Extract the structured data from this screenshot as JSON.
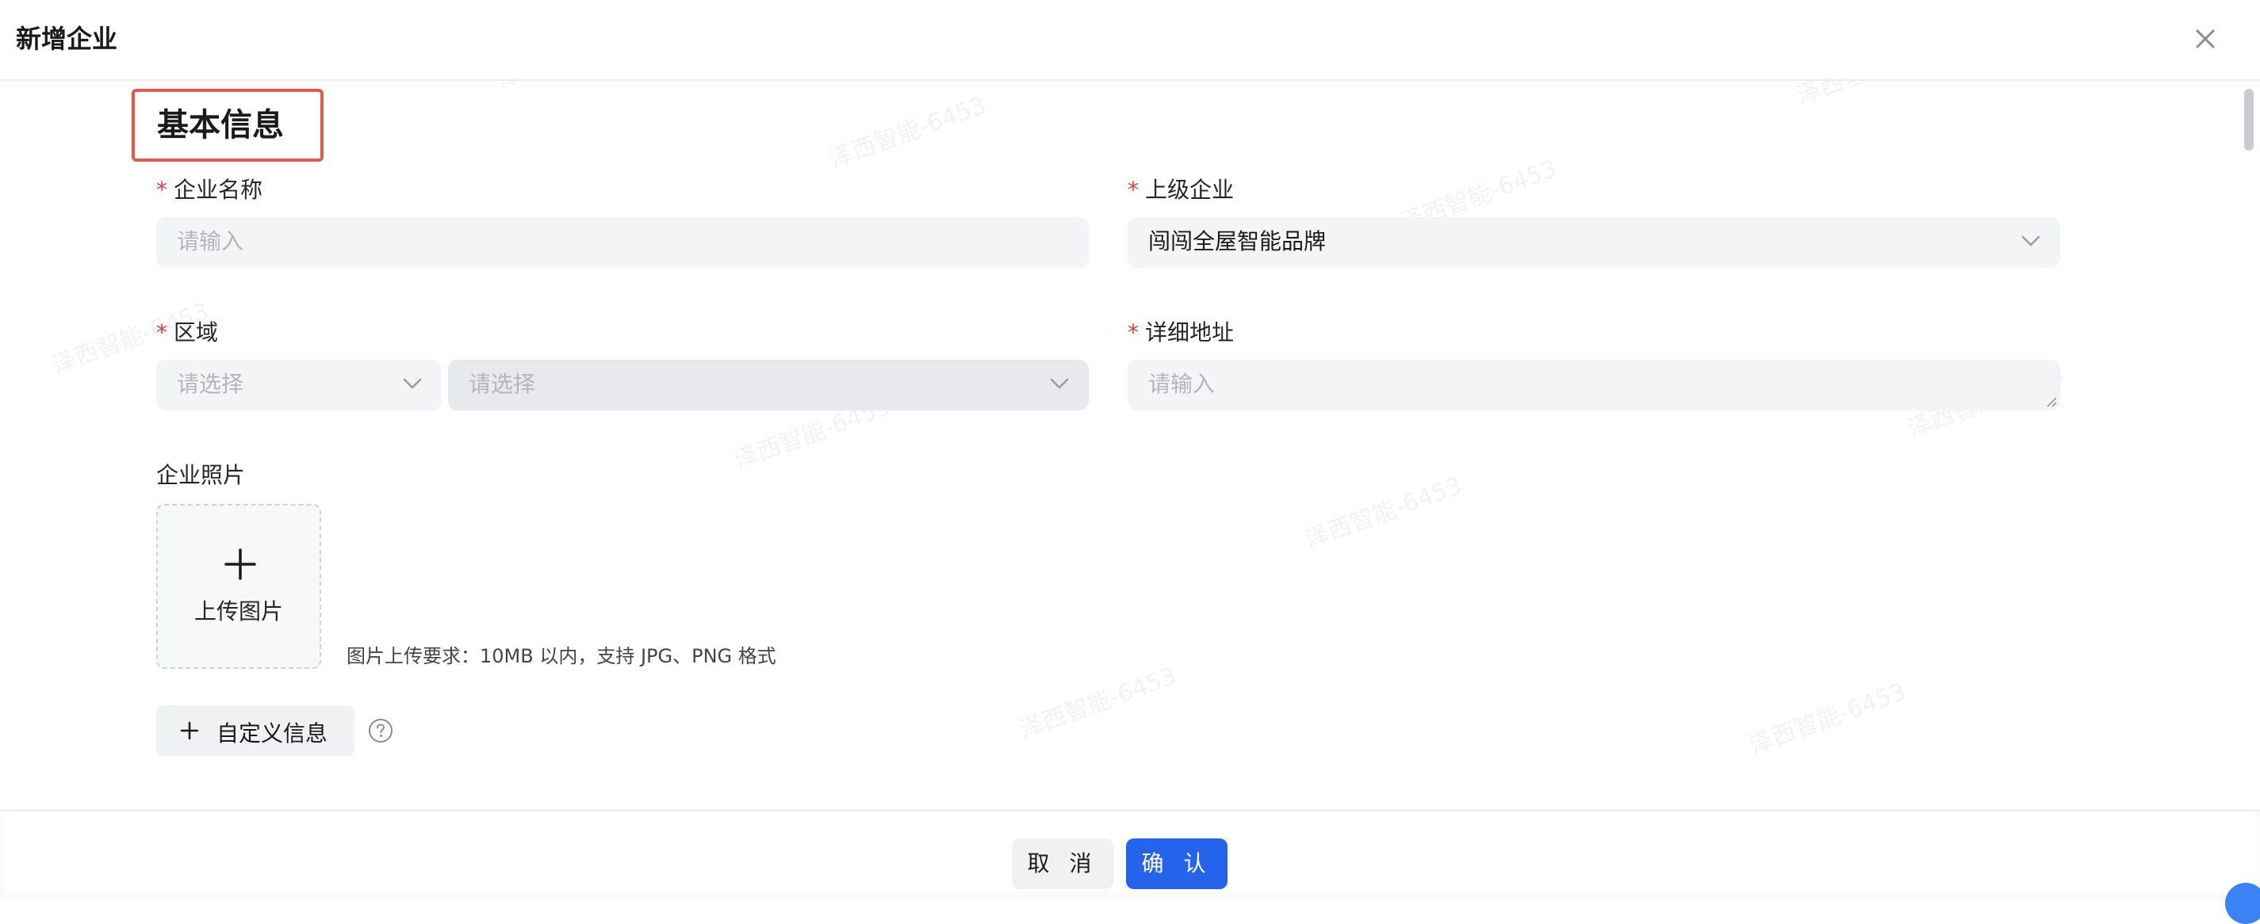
{
  "dialog": {
    "title": "新增企业"
  },
  "section": {
    "title": "基本信息"
  },
  "fields": {
    "company_name": {
      "label": "企业名称",
      "placeholder": "请输入"
    },
    "parent_company": {
      "label": "上级企业",
      "value": "闯闯全屋智能品牌"
    },
    "region": {
      "label": "区域",
      "province_placeholder": "请选择",
      "city_placeholder": "请选择"
    },
    "address": {
      "label": "详细地址",
      "placeholder": "请输入"
    },
    "photos": {
      "label": "企业照片",
      "upload_label": "上传图片",
      "hint": "图片上传要求：10MB 以内，支持 JPG、PNG 格式"
    }
  },
  "custom_info": {
    "label": "自定义信息"
  },
  "footer": {
    "cancel_label": "取 消",
    "confirm_label": "确 认"
  },
  "watermark": "泽西智能-6453",
  "colors": {
    "primary": "#2563eb",
    "required": "#e63b3b",
    "highlight_border": "#e05a4e"
  },
  "icons": [
    "close-icon",
    "chevron-down-icon",
    "plus-icon",
    "help-icon"
  ]
}
